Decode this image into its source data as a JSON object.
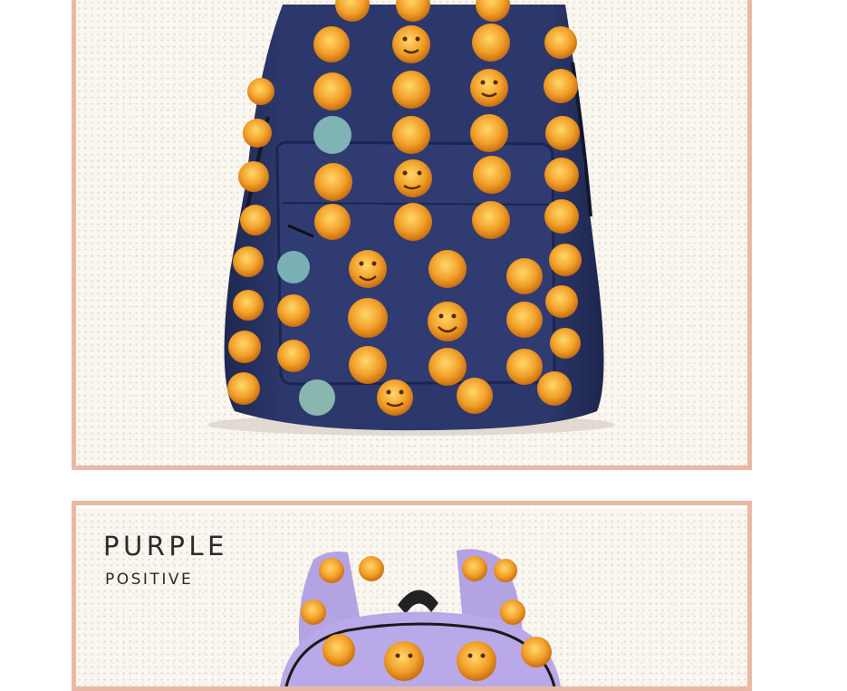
{
  "product": {
    "color_name": "PURPLE",
    "color_subtitle": "POSITIVE"
  },
  "colors": {
    "frame_border": "#e9b9a6",
    "navy_bag": "#2a3566",
    "purple_bag": "#b6a6e6",
    "emoji_face": "#f2a12a"
  }
}
